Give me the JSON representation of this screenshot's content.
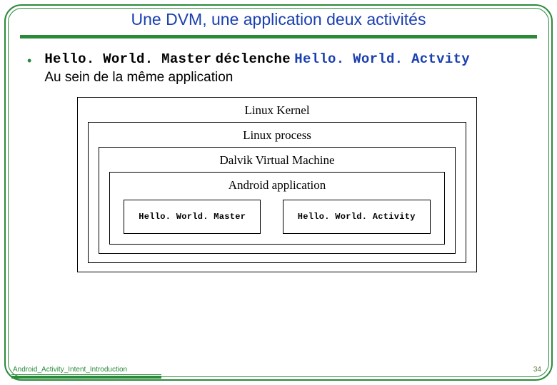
{
  "title": "Une DVM, une application deux activités",
  "bullet": {
    "code1": "Hello. World. Master",
    "middle": "déclenche",
    "code2": "Hello. World. Actvity",
    "line2": "Au sein de la même application"
  },
  "diagram": {
    "kernel": "Linux Kernel",
    "process": "Linux process",
    "dvm": "Dalvik Virtual Machine",
    "app": "Android application",
    "act1": "Hello. World. Master",
    "act2": "Hello. World. Activity"
  },
  "footer": {
    "left": "Android_Activity_Intent_Introduction",
    "page": "34"
  }
}
